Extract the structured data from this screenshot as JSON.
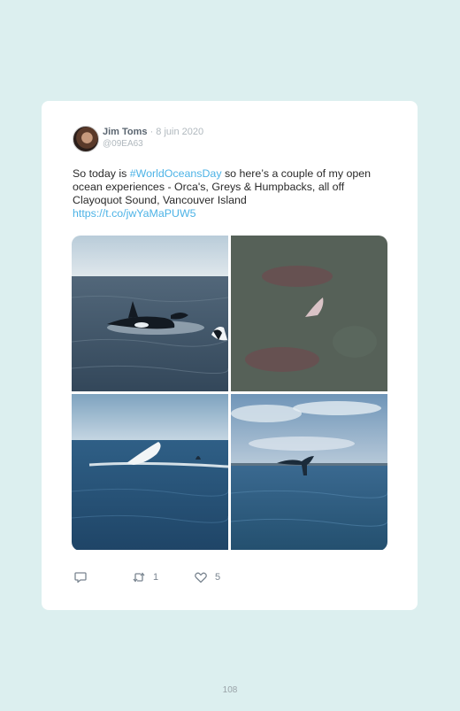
{
  "tweet": {
    "author_name": "Jim Toms",
    "date": " · 8 juin 2020",
    "handle": "@09EA63",
    "text_part1": "So today is ",
    "hashtag": "#WorldOceansDay",
    "text_part2": " so here’s a couple of my open ocean experiences - Orca's, Greys & Humpbacks, all off Clayoquot Sound, Vancouver Island",
    "link": "https://t.co/jwYaMaPUW5"
  },
  "media": [
    {
      "description": "orca-photo"
    },
    {
      "description": "grey-whale-underwater-photo"
    },
    {
      "description": "humpback-breach-photo"
    },
    {
      "description": "humpback-tail-photo"
    }
  ],
  "actions": {
    "reply_count": "",
    "retweet_count": "1",
    "like_count": "5"
  },
  "page_number": "108",
  "colors": {
    "background": "#dcefef",
    "card": "#ffffff",
    "link": "#4db3e6"
  }
}
